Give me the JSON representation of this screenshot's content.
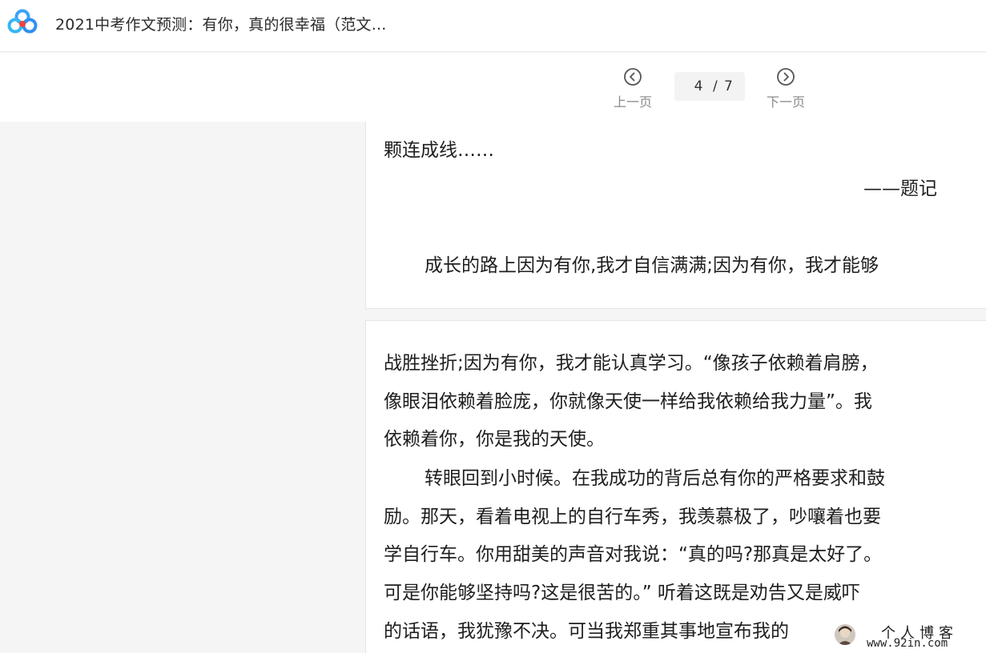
{
  "header": {
    "logo_icon": "baidu-wenku-cloud-logo",
    "title": "2021中考作文预测：有你，真的很幸福（范文..."
  },
  "pager": {
    "prev_label": "上一页",
    "next_label": "下一页",
    "current": "4",
    "separator": "/",
    "total": "7"
  },
  "page1": {
    "lines": [
      "颗连成线……",
      "——题记",
      "成长的路上因为有你,我才自信满满;因为有你，我才能够"
    ]
  },
  "page2": {
    "lines": [
      "战胜挫折;因为有你，我才能认真学习。“像孩子依赖着肩膀，",
      "像眼泪依赖着脸庞，你就像天使一样给我依赖给我力量”。我",
      "依赖着你，你是我的天使。",
      "转眼回到小时候。在我成功的背后总有你的严格要求和鼓",
      "励。那天，看着电视上的自行车秀，我羡慕极了，吵嚷着也要",
      "学自行车。你用甜美的声音对我说：“真的吗?那真是太好了。",
      "可是你能够坚持吗?这是很苦的。” 听着这既是劝告又是威吓",
      "的话语，我犹豫不决。可当我郑重其事地宣布我的"
    ]
  },
  "watermark": {
    "title": "个人博客",
    "url": "www.92in.com"
  },
  "colors": {
    "background": "#f5f5f6",
    "page": "#ffffff",
    "text": "#1e1e1e",
    "muted": "#8a8a8a"
  }
}
